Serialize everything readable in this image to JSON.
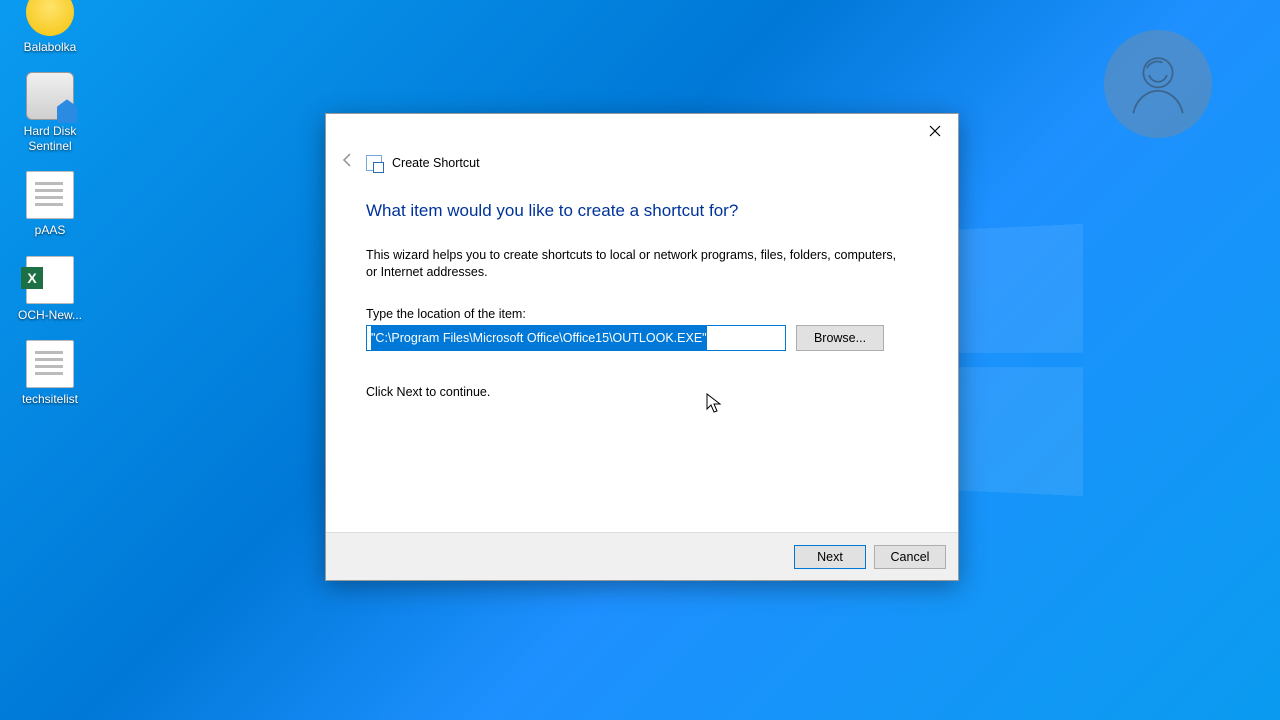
{
  "desktop": {
    "icons": [
      {
        "label": "Balabolka"
      },
      {
        "label": "Hard Disk Sentinel"
      },
      {
        "label": "pAAS"
      },
      {
        "label": "OCH-New..."
      },
      {
        "label": "techsitelist"
      }
    ]
  },
  "dialog": {
    "title": "Create Shortcut",
    "heading": "What item would you like to create a shortcut for?",
    "description": "This wizard helps you to create shortcuts to local or network programs, files, folders, computers, or Internet addresses.",
    "location_label": "Type the location of the item:",
    "location_value": "\"C:\\Program Files\\Microsoft Office\\Office15\\OUTLOOK.EXE\"",
    "browse_label": "Browse...",
    "hint": "Click Next to continue.",
    "next_label": "Next",
    "cancel_label": "Cancel"
  }
}
